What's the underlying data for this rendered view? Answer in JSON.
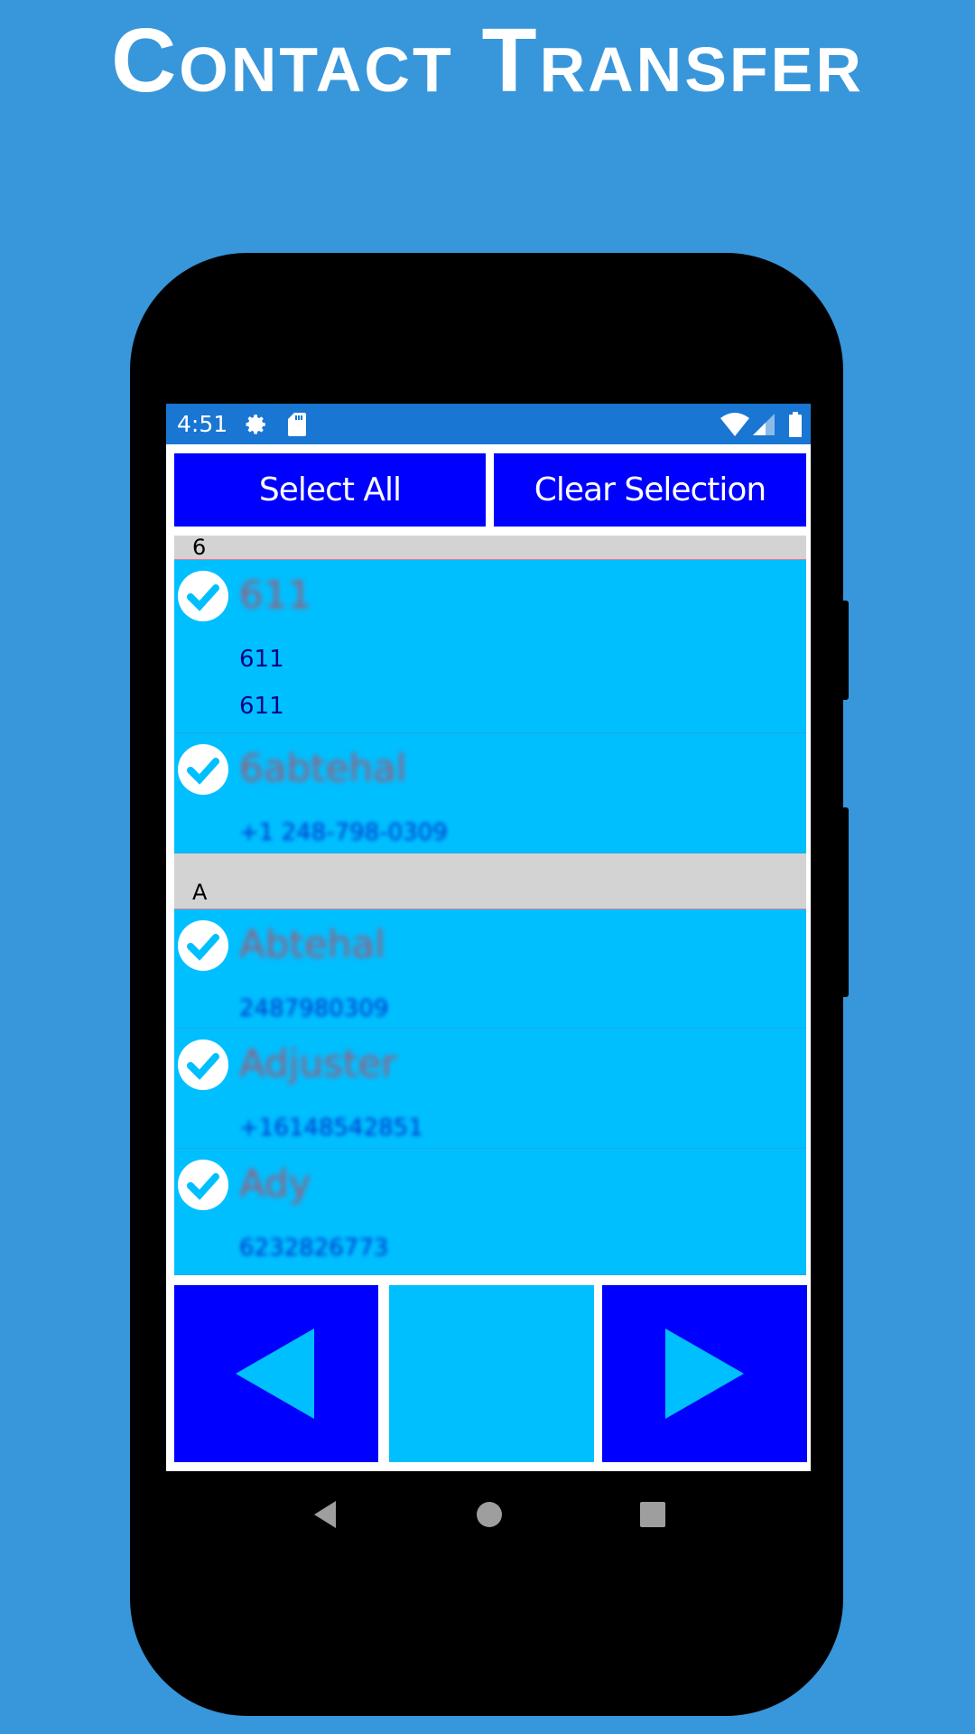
{
  "banner": {
    "title": "Contact Transfer"
  },
  "status_bar": {
    "time": "4:51",
    "icons": [
      "gear-icon",
      "sd-card-icon",
      "wifi-icon",
      "signal-icon",
      "battery-icon"
    ]
  },
  "toolbar": {
    "select_all": "Select All",
    "clear_selection": "Clear Selection"
  },
  "sections": [
    {
      "header": "6",
      "contacts": [
        {
          "name": "611",
          "numbers": [
            "611",
            "611"
          ],
          "checked": true
        },
        {
          "name": "6abtehal",
          "numbers": [
            "+1 248-798-0309"
          ],
          "checked": true
        }
      ]
    },
    {
      "header": "A",
      "contacts": [
        {
          "name": "Abtehal",
          "numbers": [
            "2487980309"
          ],
          "checked": true
        },
        {
          "name": "Adjuster",
          "numbers": [
            "+16148542851"
          ],
          "checked": true
        },
        {
          "name": "Ady",
          "numbers": [
            "6232826773"
          ],
          "checked": true
        }
      ]
    }
  ],
  "pager": {
    "prev": "previous-arrow-icon",
    "next": "next-arrow-icon"
  },
  "colors": {
    "background": "#3896da",
    "status": "#1976d2",
    "button": "#0000ff",
    "row": "#00bfff",
    "header": "#d3d3d3"
  }
}
